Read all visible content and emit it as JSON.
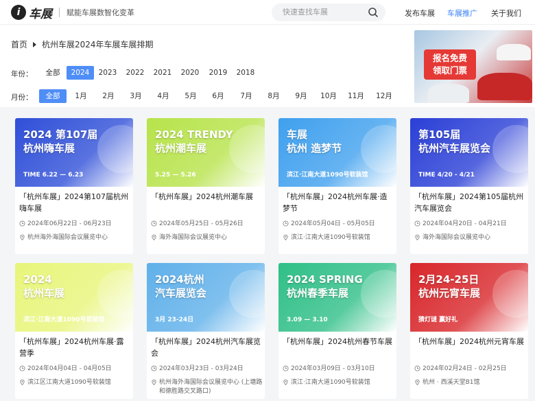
{
  "header": {
    "logo_mark": "i",
    "logo_text": "车展",
    "slogan": "赋能车展数智化变革",
    "search_placeholder": "快速查找车展",
    "nav": [
      "发布车展",
      "车展推广",
      "关于我们"
    ]
  },
  "breadcrumb": {
    "home": "首页",
    "current": "杭州车展2024年车展车展排期"
  },
  "year_filter": {
    "label": "年份：",
    "options": [
      "全部",
      "2024",
      "2023",
      "2022",
      "2021",
      "2020",
      "2019",
      "2018"
    ],
    "selected": "2024"
  },
  "month_filter": {
    "label": "月份：",
    "options": [
      "全部",
      "1月",
      "2月",
      "3月",
      "4月",
      "5月",
      "6月",
      "7月",
      "8月",
      "9月",
      "10月",
      "11月",
      "12月"
    ],
    "selected": "全部"
  },
  "banner": {
    "line1": "报名免费",
    "line2": "领取门票"
  },
  "cards": [
    {
      "title": "「杭州车展」2024第107届杭州嗨车展",
      "date": "2024年06月22日 - 06月23日",
      "location": "杭州海外海国际会议展览中心",
      "img_head": "2024 第107届\n杭州嗨车展",
      "img_sub": "TIME 6.22 — 6.23",
      "bg": "#2f4fd8"
    },
    {
      "title": "「杭州车展」2024杭州潮车展",
      "date": "2024年05月25日 - 05月26日",
      "location": "海外海国际会议展览中心",
      "img_head": "2024 TRENDY\n杭州潮车展",
      "img_sub": "5.25 — 5.26",
      "bg": "#b7e34a"
    },
    {
      "title": "「杭州车展」2024杭州车展·造梦节",
      "date": "2024年05月04日 - 05月05日",
      "location": "滨江·江南大道1090号软装馆",
      "img_head": "车展\n杭州 造梦节",
      "img_sub": "滨江·江南大道1090号软装馆",
      "bg": "#3fa0ee"
    },
    {
      "title": "「杭州车展」2024第105届杭州汽车展览会",
      "date": "2024年04月20日 - 04月21日",
      "location": "海外海国际会议展览中心",
      "img_head": "第105届\n杭州汽车展览会",
      "img_sub": "TIME 4/20 - 4/21",
      "bg": "#2a3fd6"
    },
    {
      "title": "「杭州车展」2024杭州车展·露营季",
      "date": "2024年04月04日 - 04月05日",
      "location": "滨江区江南大道1090号软装馆",
      "img_head": "2024\n杭州车展",
      "img_sub": "滨江·江南大道1090号软装馆",
      "bg": "#e8f57a"
    },
    {
      "title": "「杭州车展」2024杭州汽车展览会",
      "date": "2024年03月23日 - 03月24日",
      "location": "杭州海外海国际会议展览中心 (上塘路和德胜路交叉路口)",
      "img_head": "2024杭州\n汽车展览会",
      "img_sub": "3月 23-24日",
      "bg": "#5fb0ea"
    },
    {
      "title": "「杭州车展」2024杭州春节车展",
      "date": "2024年03月09日 - 03月10日",
      "location": "滨江·江南大道1090号软装馆",
      "img_head": "2024 SPRING\n杭州春季车展",
      "img_sub": "3.09 — 3.10",
      "bg": "#2fbf87"
    },
    {
      "title": "「杭州车展」2024杭州元宵车展",
      "date": "2024年02月24日 - 02月25日",
      "location": "杭州 · 西溪天堂B1馆",
      "img_head": "2月24-25日\n杭州元宵车展",
      "img_sub": "猜灯谜 赢好礼",
      "bg": "#d8262a"
    }
  ],
  "colors": {
    "accent": "#4f8ef7",
    "nav_active": "#3b82f6"
  }
}
